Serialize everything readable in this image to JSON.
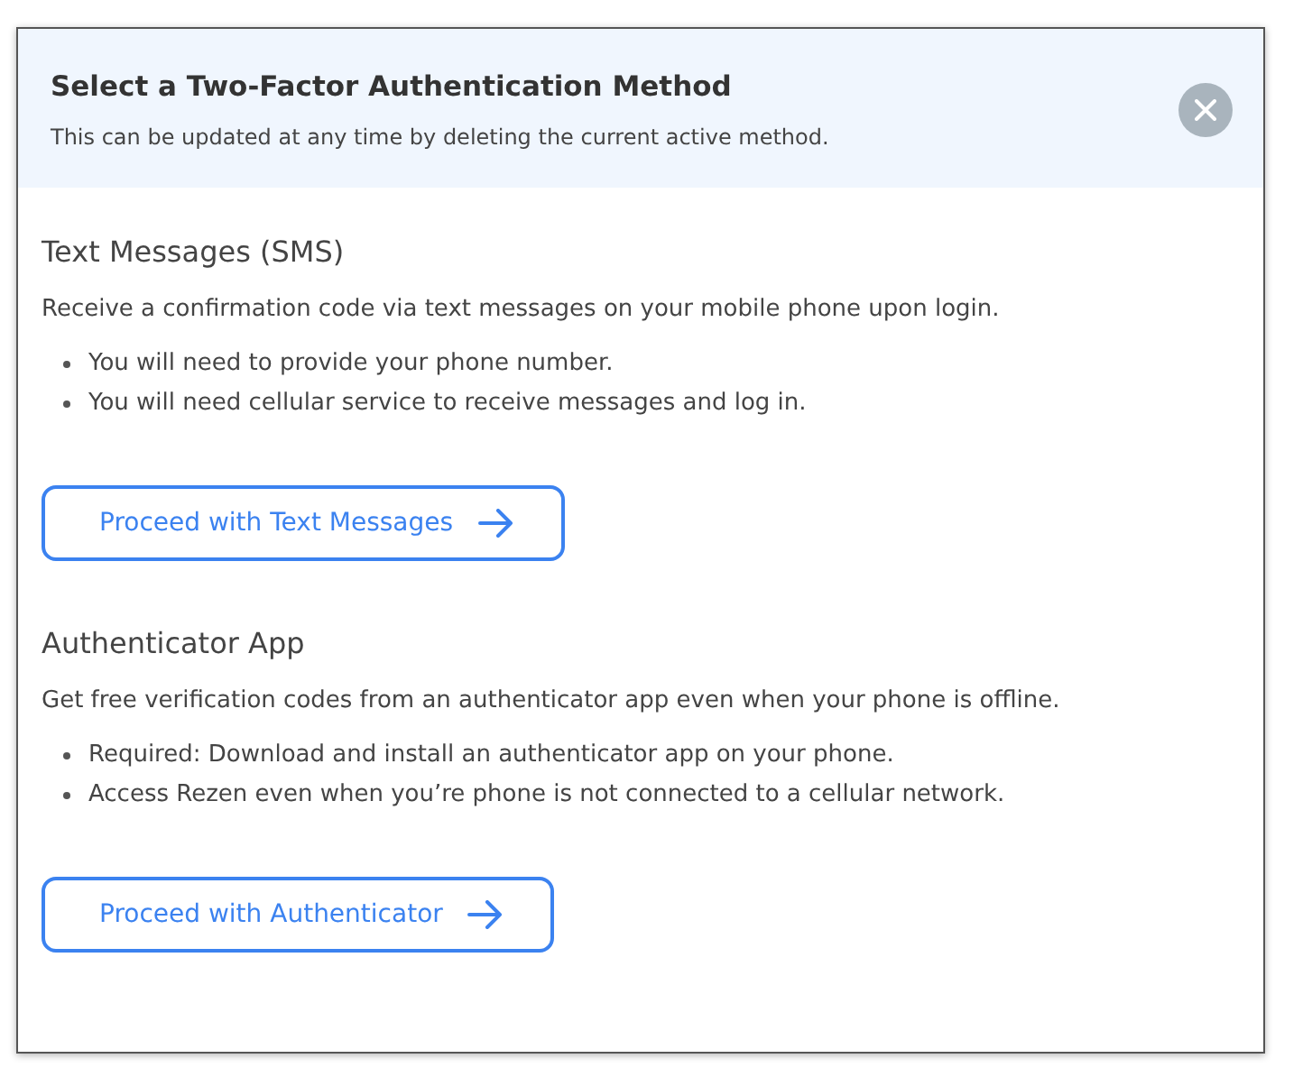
{
  "dialog": {
    "title": "Select a Two-Factor Authentication Method",
    "subtitle": "This can be updated at any time by deleting the current active method."
  },
  "methods": [
    {
      "title": "Text Messages (SMS)",
      "description": "Receive a confirmation code via text messages on your mobile phone upon login.",
      "bullets": [
        "You will need to provide your phone number.",
        "You will need cellular service to receive messages and log in."
      ],
      "button": "Proceed with Text Messages"
    },
    {
      "title": "Authenticator App",
      "description": "Get free verification codes from an authenticator app even when your phone is offline.",
      "bullets": [
        "Required: Download and install an authenticator app on your phone.",
        "Access Rezen even when you’re phone is not connected to a cellular network."
      ],
      "button": "Proceed with Authenticator"
    }
  ]
}
